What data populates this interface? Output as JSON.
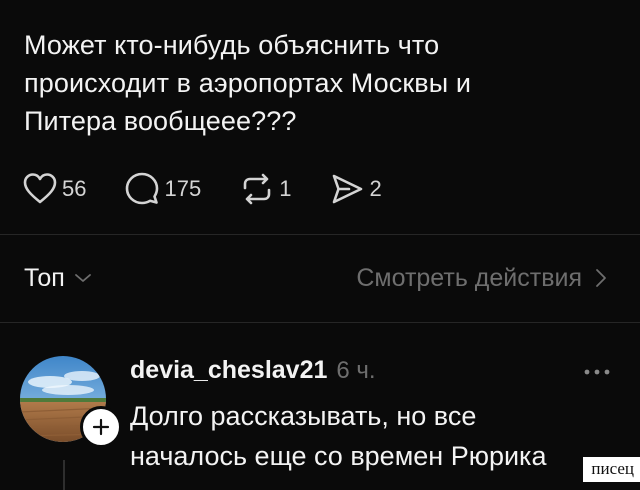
{
  "post": {
    "text": "Может кто-нибудь объяснить что\nпроисходит в аэропортах Москвы и\nПитера вообщеее???"
  },
  "actions": {
    "likes": "56",
    "replies": "175",
    "reposts": "1",
    "shares": "2"
  },
  "sort": {
    "label": "Топ",
    "view_activity": "Смотреть действия"
  },
  "comment": {
    "username": "devia_cheslav21",
    "time": "6 ч.",
    "text": "Долго рассказывать, но все\nначалось еще со времен Рюрика"
  },
  "watermark": {
    "text": "писец"
  },
  "icons": {
    "like": "heart-icon",
    "reply": "comment-bubble-icon",
    "repost": "repost-icon",
    "share": "send-icon",
    "more": "more-dots-icon",
    "follow": "plus-icon"
  },
  "colors": {
    "background": "#0a0a0a",
    "text": "#f3f3f3",
    "muted": "#6e6e6e"
  }
}
